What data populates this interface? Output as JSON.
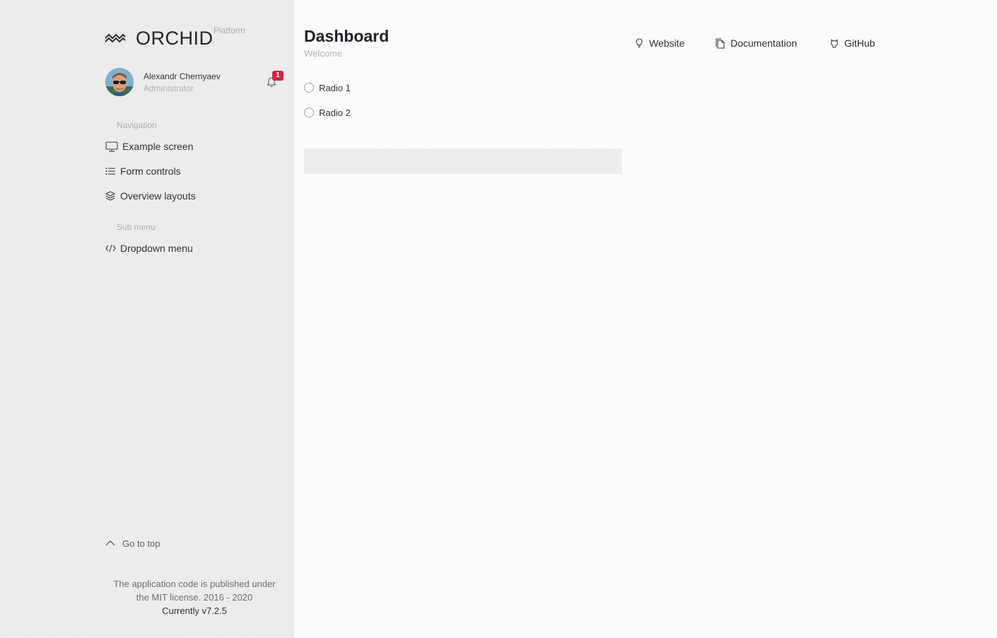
{
  "brand": {
    "name": "ORCHID",
    "subtitle": "Platform",
    "logo_icon": "orchid-logo-icon"
  },
  "profile": {
    "name": "Alexandr Chernyaev",
    "role": "Administrator",
    "notification_icon": "bell-icon",
    "notification_count": "1"
  },
  "sidebar": {
    "sections": [
      {
        "heading": "Navigation",
        "items": [
          {
            "label": "Example screen",
            "icon": "monitor-icon"
          },
          {
            "label": "Form controls",
            "icon": "list-icon"
          },
          {
            "label": "Overview layouts",
            "icon": "layers-icon"
          }
        ]
      },
      {
        "heading": "Sub menu",
        "items": [
          {
            "label": "Dropdown menu",
            "icon": "code-icon"
          }
        ]
      }
    ],
    "go_top": {
      "label": "Go to top",
      "icon": "chevron-up-icon"
    },
    "footer": {
      "line1": "The application code is published under",
      "line2": "the MIT license. 2016 - 2020",
      "version": "Currently v7.2.5"
    }
  },
  "header": {
    "title": "Dashboard",
    "subtitle": "Welcome",
    "links": [
      {
        "label": "Website",
        "icon": "bulb-icon"
      },
      {
        "label": "Documentation",
        "icon": "docs-icon"
      },
      {
        "label": "GitHub",
        "icon": "github-icon"
      }
    ]
  },
  "main": {
    "radios": [
      {
        "label": "Radio 1",
        "checked": false
      },
      {
        "label": "Radio 2",
        "checked": false
      }
    ]
  },
  "colors": {
    "badge": "#d8233f",
    "accent_text": "#21252a",
    "muted": "#a9aeb3"
  }
}
